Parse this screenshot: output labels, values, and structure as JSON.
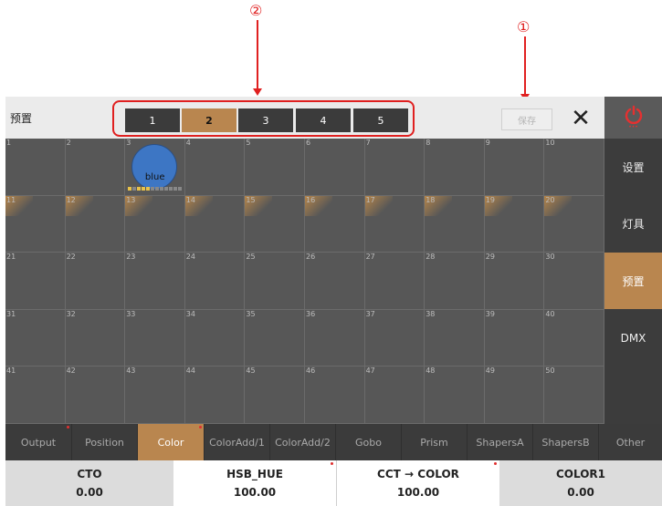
{
  "annotations": {
    "callout_1": "①",
    "callout_2": "②"
  },
  "header": {
    "title": "预置",
    "pages": [
      "1",
      "2",
      "3",
      "4",
      "5"
    ],
    "active_page": "2",
    "save_label": "保存",
    "close_symbol": "✕"
  },
  "grid": {
    "cells": [
      "1",
      "2",
      "3",
      "4",
      "5",
      "6",
      "7",
      "8",
      "9",
      "10",
      "11",
      "12",
      "13",
      "14",
      "15",
      "16",
      "17",
      "18",
      "19",
      "20",
      "21",
      "22",
      "23",
      "24",
      "25",
      "26",
      "27",
      "28",
      "29",
      "30",
      "31",
      "32",
      "33",
      "34",
      "35",
      "36",
      "37",
      "38",
      "39",
      "40",
      "41",
      "42",
      "43",
      "44",
      "45",
      "46",
      "47",
      "48",
      "49",
      "50"
    ],
    "preset_label": "blue"
  },
  "sidebar": {
    "items": [
      {
        "label": "设置"
      },
      {
        "label": "灯具"
      },
      {
        "label": "预置"
      },
      {
        "label": "DMX"
      }
    ]
  },
  "tabs": [
    "Output",
    "Position",
    "Color",
    "ColorAdd/1",
    "ColorAdd/2",
    "Gobo",
    "Prism",
    "ShapersA",
    "ShapersB",
    "Other"
  ],
  "params": [
    {
      "name": "CTO",
      "value": "0.00"
    },
    {
      "name": "HSB_HUE",
      "value": "100.00"
    },
    {
      "name": "CCT → COLOR",
      "value": "100.00"
    },
    {
      "name": "COLOR1",
      "value": "0.00"
    }
  ],
  "colors": {
    "accent": "#b9864f",
    "annotation": "#e02020",
    "preset_blue": "#3d76c4"
  }
}
